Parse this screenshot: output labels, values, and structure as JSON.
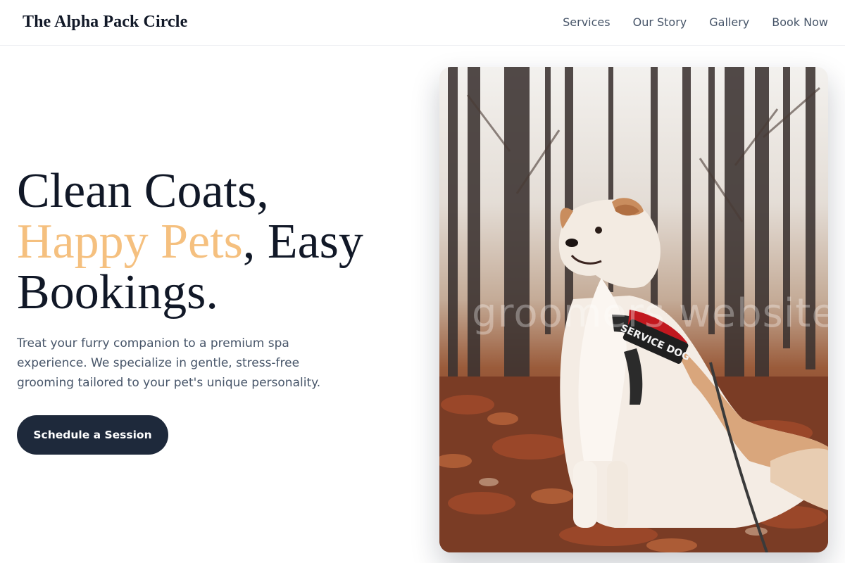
{
  "header": {
    "brand": "The Alpha Pack Circle",
    "nav": [
      "Services",
      "Our Story",
      "Gallery",
      "Book Now"
    ]
  },
  "hero": {
    "title_line1": "Clean Coats,",
    "title_accent": "Happy Pets",
    "title_line2_rest": ", Easy",
    "title_line3": "Bookings.",
    "description": "Treat your furry companion to a premium spa experience. We specialize in gentle, stress-free grooming tailored to your pet's unique personality.",
    "cta_label": "Schedule a Session",
    "image_watermark": "groomers website",
    "harness_label": "SERVICE DOG"
  },
  "colors": {
    "accent": "#f5c07f",
    "primary_dark": "#1e293b",
    "text_muted": "#475569"
  }
}
